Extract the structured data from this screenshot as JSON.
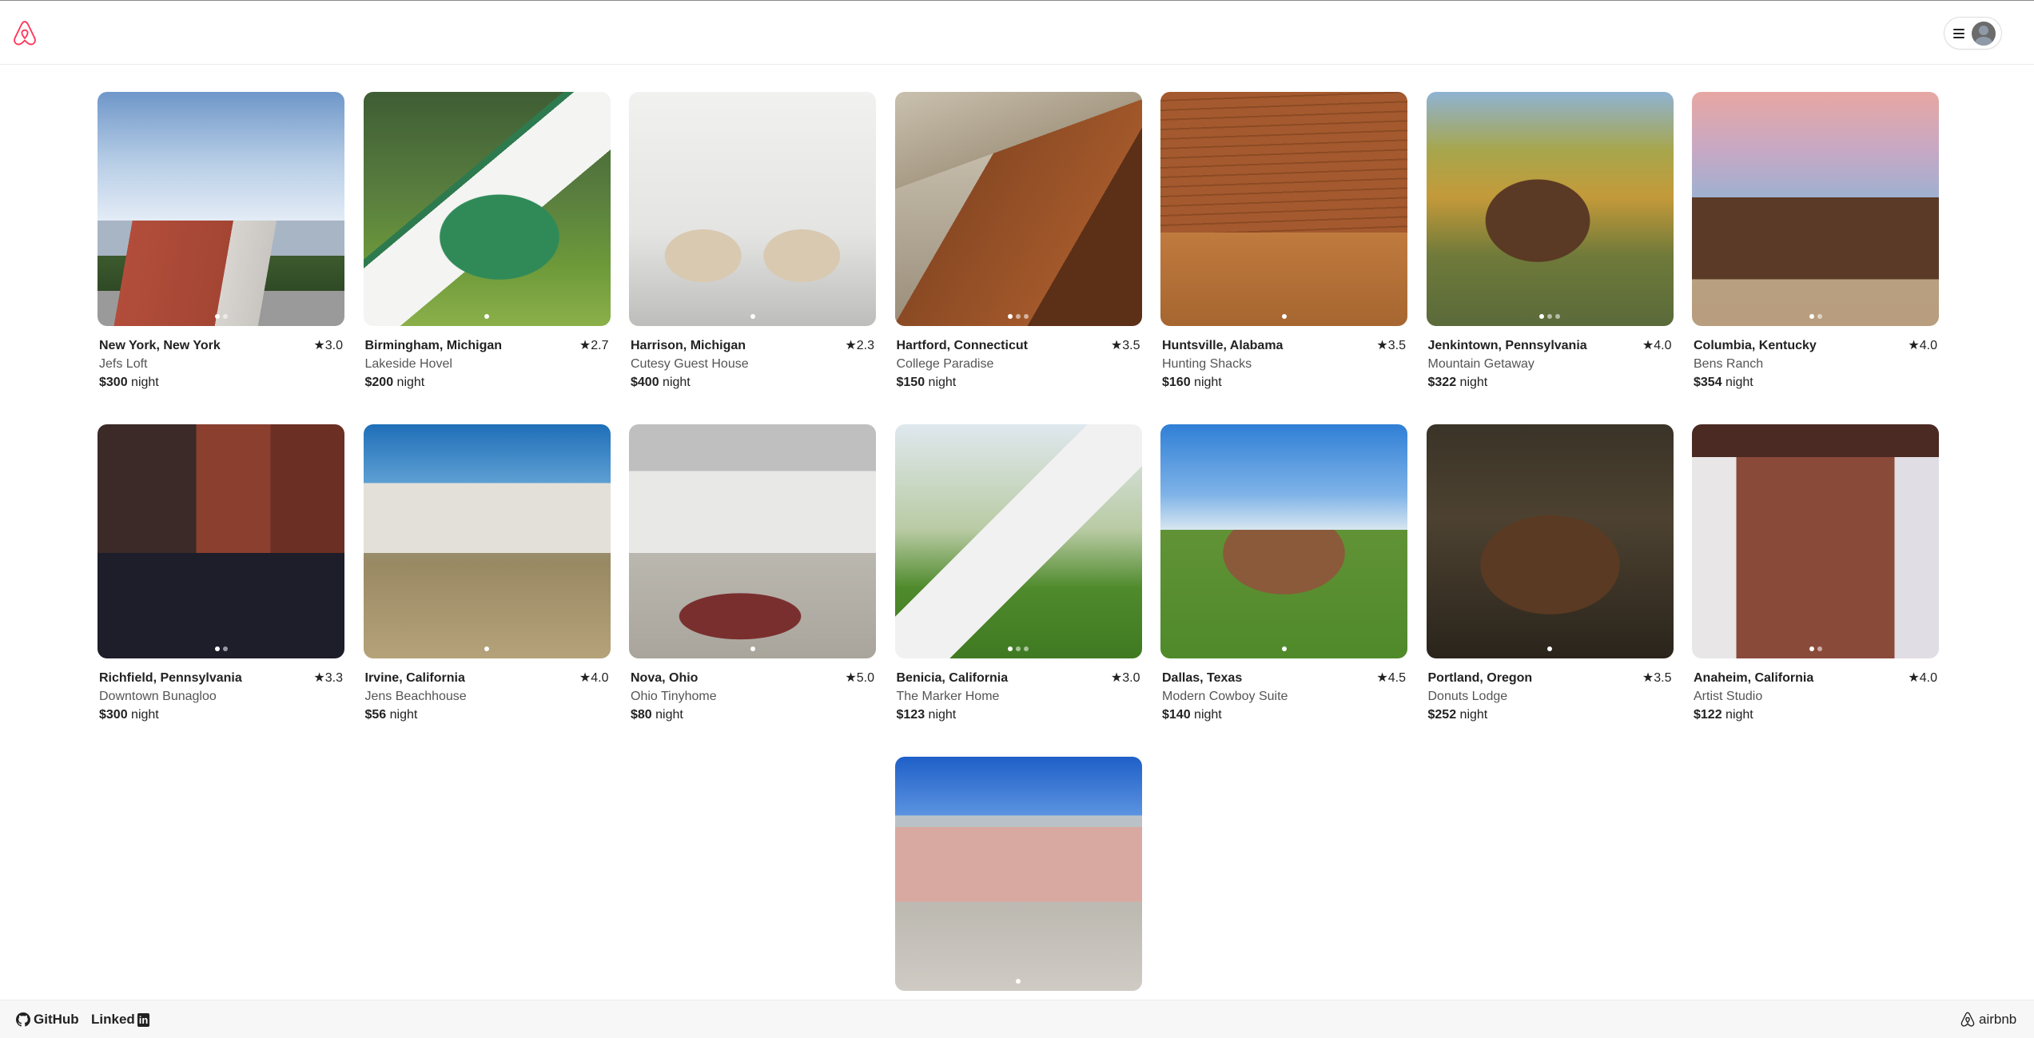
{
  "header": {
    "logo_icon": "airbnb-logo-icon",
    "menu_icon": "hamburger-icon",
    "avatar_icon": "user-avatar-icon",
    "brand_color": "#ff385c"
  },
  "listings": [
    {
      "location": "New York, New York",
      "name": "Jefs Loft",
      "rating": "★3.0",
      "price": "$300",
      "unit": "night",
      "photos": 2,
      "active_photo": 0,
      "scene": "apartment-building"
    },
    {
      "location": "Birmingham, Michigan",
      "name": "Lakeside Hovel",
      "rating": "★2.7",
      "price": "$200",
      "unit": "night",
      "photos": 1,
      "active_photo": 0,
      "scene": "hobbit-house"
    },
    {
      "location": "Harrison, Michigan",
      "name": "Cutesy Guest House",
      "rating": "★2.3",
      "price": "$400",
      "unit": "night",
      "photos": 1,
      "active_photo": 0,
      "scene": "white-living-room"
    },
    {
      "location": "Hartford, Connecticut",
      "name": "College Paradise",
      "rating": "★3.5",
      "price": "$150",
      "unit": "night",
      "photos": 3,
      "active_photo": 0,
      "scene": "dining-table"
    },
    {
      "location": "Huntsville, Alabama",
      "name": "Hunting Shacks",
      "rating": "★3.5",
      "price": "$160",
      "unit": "night",
      "photos": 1,
      "active_photo": 0,
      "scene": "log-cabin-interior"
    },
    {
      "location": "Jenkintown, Pennsylvania",
      "name": "Mountain Getaway",
      "rating": "★4.0",
      "price": "$322",
      "unit": "night",
      "photos": 3,
      "active_photo": 0,
      "scene": "forest-cabin"
    },
    {
      "location": "Columbia, Kentucky",
      "name": "Bens Ranch",
      "rating": "★4.0",
      "price": "$354",
      "unit": "night",
      "photos": 2,
      "active_photo": 0,
      "scene": "ranch-house"
    },
    {
      "location": "Richfield, Pennsylvania",
      "name": "Downtown Bunagloo",
      "rating": "★3.3",
      "price": "$300",
      "unit": "night",
      "photos": 2,
      "active_photo": 0,
      "scene": "brick-storefront"
    },
    {
      "location": "Irvine, California",
      "name": "Jens Beachhouse",
      "rating": "★4.0",
      "price": "$56",
      "unit": "night",
      "photos": 1,
      "active_photo": 0,
      "scene": "beach-house"
    },
    {
      "location": "Nova, Ohio",
      "name": "Ohio Tinyhome",
      "rating": "★5.0",
      "price": "$80",
      "unit": "night",
      "photos": 1,
      "active_photo": 0,
      "scene": "loft-kitchen"
    },
    {
      "location": "Benicia, California",
      "name": "The Marker Home",
      "rating": "★3.0",
      "price": "$123",
      "unit": "night",
      "photos": 3,
      "active_photo": 0,
      "scene": "a-frame"
    },
    {
      "location": "Dallas, Texas",
      "name": "Modern Cowboy Suite",
      "rating": "★4.5",
      "price": "$140",
      "unit": "night",
      "photos": 1,
      "active_photo": 0,
      "scene": "tiny-house-lawn"
    },
    {
      "location": "Portland, Oregon",
      "name": "Donuts Lodge",
      "rating": "★3.5",
      "price": "$252",
      "unit": "night",
      "photos": 1,
      "active_photo": 0,
      "scene": "treehouse"
    },
    {
      "location": "Anaheim, California",
      "name": "Artist Studio",
      "rating": "★4.0",
      "price": "$122",
      "unit": "night",
      "photos": 2,
      "active_photo": 0,
      "scene": "brick-studio"
    },
    {
      "location": "",
      "name": "",
      "rating": "",
      "price": "",
      "unit": "",
      "photos": 1,
      "active_photo": 0,
      "scene": "pink-bungalow"
    }
  ],
  "footer": {
    "github_label": "GitHub",
    "linkedin_label": "Linked",
    "linkedin_box": "in",
    "brand_label": "airbnb",
    "github_icon": "github-icon",
    "linkedin_icon": "linkedin-icon",
    "brand_icon": "airbnb-logo-icon"
  }
}
